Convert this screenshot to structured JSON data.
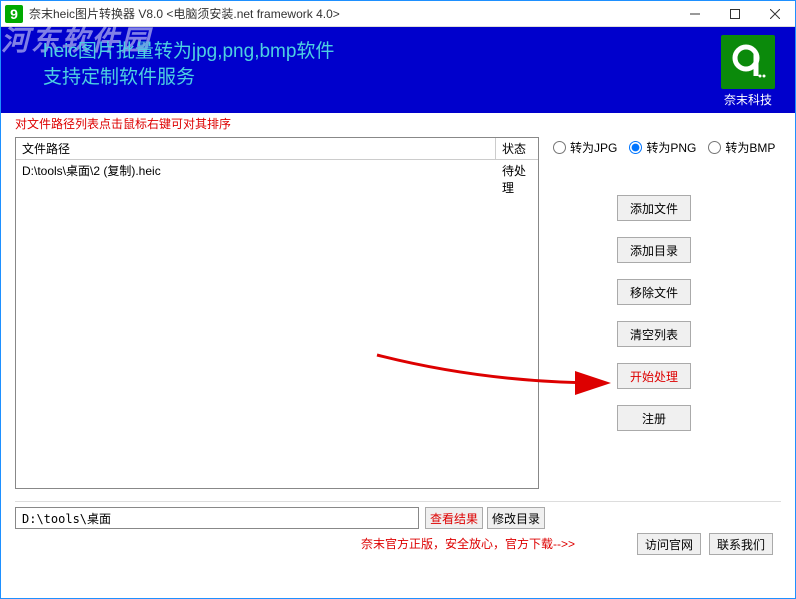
{
  "title": "奈末heic图片转换器 V8.0 <电脑须安装.net framework 4.0>",
  "banner": {
    "watermark": "河东软件园",
    "line1": "heic图片批量转为jpg,png,bmp软件",
    "line2": "支持定制软件服务",
    "logo_text": "奈末科技"
  },
  "hint": "对文件路径列表点击鼠标右键可对其排序",
  "list": {
    "col_path": "文件路径",
    "col_status": "状态",
    "rows": [
      {
        "path": "D:\\tools\\桌面\\2 (复制).heic",
        "status": "待处理"
      }
    ]
  },
  "radios": {
    "jpg": "转为JPG",
    "png": "转为PNG",
    "bmp": "转为BMP",
    "selected": "png"
  },
  "buttons": {
    "add_file": "添加文件",
    "add_dir": "添加目录",
    "remove": "移除文件",
    "clear": "清空列表",
    "start": "开始处理",
    "register": "注册",
    "view_result": "查看结果",
    "modify_dir": "修改目录",
    "visit_site": "访问官网",
    "contact": "联系我们"
  },
  "output_path": "D:\\tools\\桌面",
  "footer": "奈末官方正版，安全放心，官方下载-->>"
}
